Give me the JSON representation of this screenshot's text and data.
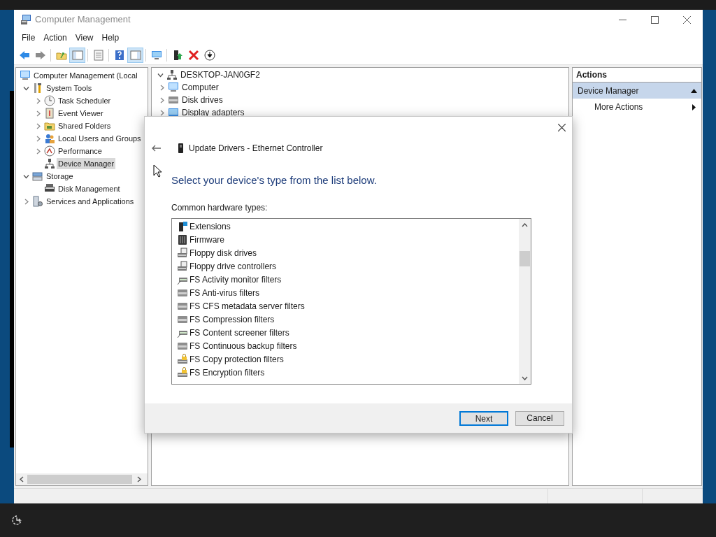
{
  "window": {
    "title": "Computer Management"
  },
  "menu": [
    "File",
    "Action",
    "View",
    "Help"
  ],
  "toolbar": [
    [
      {
        "pressed": false
      },
      {
        "pressed": false
      }
    ],
    [
      {
        "pressed": false
      },
      {
        "pressed": true
      }
    ],
    [
      {
        "pressed": false
      }
    ],
    [
      {
        "pressed": false
      },
      {
        "pressed": true
      }
    ],
    [
      {
        "pressed": false
      }
    ],
    [
      {
        "pressed": false
      },
      {
        "pressed": false
      },
      {
        "pressed": false
      }
    ]
  ],
  "console_tree": [
    {
      "label": "Computer Management (Local",
      "selected": false,
      "children": [
        {
          "label": "System Tools",
          "expanded": true,
          "selected": false,
          "children": [
            {
              "label": "Task Scheduler",
              "expanded": false,
              "selected": false
            },
            {
              "label": "Event Viewer",
              "expanded": false,
              "selected": false
            },
            {
              "label": "Shared Folders",
              "expanded": false,
              "selected": false
            },
            {
              "label": "Local Users and Groups",
              "expanded": false,
              "selected": false
            },
            {
              "label": "Performance",
              "expanded": false,
              "selected": false
            },
            {
              "label": "Device Manager",
              "selected": true
            }
          ]
        },
        {
          "label": "Storage",
          "expanded": true,
          "selected": false,
          "children": [
            {
              "label": "Disk Management",
              "selected": false
            }
          ]
        },
        {
          "label": "Services and Applications",
          "expanded": false,
          "selected": false
        }
      ]
    }
  ],
  "device_tree": [
    {
      "label": "DESKTOP-JAN0GF2",
      "expanded": true,
      "children": [
        {
          "label": "Computer",
          "expanded": false
        },
        {
          "label": "Disk drives",
          "expanded": false
        },
        {
          "label": "Display adapters",
          "expanded": false
        }
      ]
    }
  ],
  "actions": {
    "title": "Actions",
    "section": "Device Manager",
    "items": [
      "More Actions"
    ]
  },
  "dialog": {
    "title": "Update Drivers - Ethernet Controller",
    "heading": "Select your device's type from the list below.",
    "list_label": "Common hardware types:",
    "items": [
      {
        "label": "Extensions",
        "selected": false
      },
      {
        "label": "Firmware",
        "selected": false
      },
      {
        "label": "Floppy disk drives",
        "selected": false
      },
      {
        "label": "Floppy drive controllers",
        "selected": false
      },
      {
        "label": "FS Activity monitor filters",
        "selected": false
      },
      {
        "label": "FS Anti-virus filters",
        "selected": false
      },
      {
        "label": "FS CFS metadata server filters",
        "selected": false
      },
      {
        "label": "FS Compression filters",
        "selected": false
      },
      {
        "label": "FS Content screener filters",
        "selected": false
      },
      {
        "label": "FS Continuous backup filters",
        "selected": false
      },
      {
        "label": "FS Copy protection filters",
        "selected": false
      },
      {
        "label": "FS Encryption filters",
        "selected": false
      }
    ],
    "buttons": [
      {
        "label": "Next",
        "default": true
      },
      {
        "label": "Cancel",
        "default": false
      }
    ]
  }
}
